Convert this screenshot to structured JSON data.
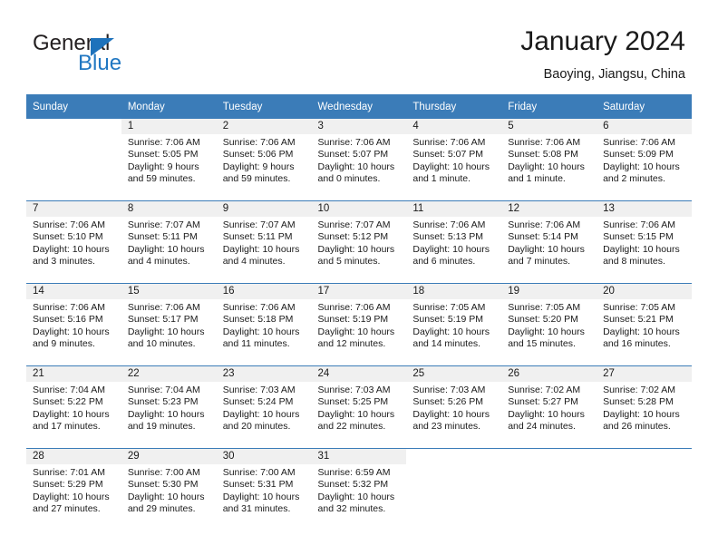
{
  "logo": {
    "word_one": "General",
    "word_two": "Blue",
    "triangle_color": "#1e72bb",
    "blue_color": "#2077c2"
  },
  "header": {
    "title": "January 2024",
    "subtitle": "Baoying, Jiangsu, China",
    "header_bg": "#3b7cb8",
    "header_text_color": "#ffffff",
    "daynum_strip_bg": "#f0f0f0"
  },
  "weekday_headers": [
    "Sunday",
    "Monday",
    "Tuesday",
    "Wednesday",
    "Thursday",
    "Friday",
    "Saturday"
  ],
  "calendar": {
    "month": "January",
    "year": "2024",
    "location": "Baoying, Jiangsu, China",
    "weeks": [
      [
        {
          "day": "",
          "sunrise": "",
          "sunset": "",
          "daylight_1": "",
          "daylight_2": ""
        },
        {
          "day": "1",
          "sunrise": "Sunrise: 7:06 AM",
          "sunset": "Sunset: 5:05 PM",
          "daylight_1": "Daylight: 9 hours",
          "daylight_2": "and 59 minutes."
        },
        {
          "day": "2",
          "sunrise": "Sunrise: 7:06 AM",
          "sunset": "Sunset: 5:06 PM",
          "daylight_1": "Daylight: 9 hours",
          "daylight_2": "and 59 minutes."
        },
        {
          "day": "3",
          "sunrise": "Sunrise: 7:06 AM",
          "sunset": "Sunset: 5:07 PM",
          "daylight_1": "Daylight: 10 hours",
          "daylight_2": "and 0 minutes."
        },
        {
          "day": "4",
          "sunrise": "Sunrise: 7:06 AM",
          "sunset": "Sunset: 5:07 PM",
          "daylight_1": "Daylight: 10 hours",
          "daylight_2": "and 1 minute."
        },
        {
          "day": "5",
          "sunrise": "Sunrise: 7:06 AM",
          "sunset": "Sunset: 5:08 PM",
          "daylight_1": "Daylight: 10 hours",
          "daylight_2": "and 1 minute."
        },
        {
          "day": "6",
          "sunrise": "Sunrise: 7:06 AM",
          "sunset": "Sunset: 5:09 PM",
          "daylight_1": "Daylight: 10 hours",
          "daylight_2": "and 2 minutes."
        }
      ],
      [
        {
          "day": "7",
          "sunrise": "Sunrise: 7:06 AM",
          "sunset": "Sunset: 5:10 PM",
          "daylight_1": "Daylight: 10 hours",
          "daylight_2": "and 3 minutes."
        },
        {
          "day": "8",
          "sunrise": "Sunrise: 7:07 AM",
          "sunset": "Sunset: 5:11 PM",
          "daylight_1": "Daylight: 10 hours",
          "daylight_2": "and 4 minutes."
        },
        {
          "day": "9",
          "sunrise": "Sunrise: 7:07 AM",
          "sunset": "Sunset: 5:11 PM",
          "daylight_1": "Daylight: 10 hours",
          "daylight_2": "and 4 minutes."
        },
        {
          "day": "10",
          "sunrise": "Sunrise: 7:07 AM",
          "sunset": "Sunset: 5:12 PM",
          "daylight_1": "Daylight: 10 hours",
          "daylight_2": "and 5 minutes."
        },
        {
          "day": "11",
          "sunrise": "Sunrise: 7:06 AM",
          "sunset": "Sunset: 5:13 PM",
          "daylight_1": "Daylight: 10 hours",
          "daylight_2": "and 6 minutes."
        },
        {
          "day": "12",
          "sunrise": "Sunrise: 7:06 AM",
          "sunset": "Sunset: 5:14 PM",
          "daylight_1": "Daylight: 10 hours",
          "daylight_2": "and 7 minutes."
        },
        {
          "day": "13",
          "sunrise": "Sunrise: 7:06 AM",
          "sunset": "Sunset: 5:15 PM",
          "daylight_1": "Daylight: 10 hours",
          "daylight_2": "and 8 minutes."
        }
      ],
      [
        {
          "day": "14",
          "sunrise": "Sunrise: 7:06 AM",
          "sunset": "Sunset: 5:16 PM",
          "daylight_1": "Daylight: 10 hours",
          "daylight_2": "and 9 minutes."
        },
        {
          "day": "15",
          "sunrise": "Sunrise: 7:06 AM",
          "sunset": "Sunset: 5:17 PM",
          "daylight_1": "Daylight: 10 hours",
          "daylight_2": "and 10 minutes."
        },
        {
          "day": "16",
          "sunrise": "Sunrise: 7:06 AM",
          "sunset": "Sunset: 5:18 PM",
          "daylight_1": "Daylight: 10 hours",
          "daylight_2": "and 11 minutes."
        },
        {
          "day": "17",
          "sunrise": "Sunrise: 7:06 AM",
          "sunset": "Sunset: 5:19 PM",
          "daylight_1": "Daylight: 10 hours",
          "daylight_2": "and 12 minutes."
        },
        {
          "day": "18",
          "sunrise": "Sunrise: 7:05 AM",
          "sunset": "Sunset: 5:19 PM",
          "daylight_1": "Daylight: 10 hours",
          "daylight_2": "and 14 minutes."
        },
        {
          "day": "19",
          "sunrise": "Sunrise: 7:05 AM",
          "sunset": "Sunset: 5:20 PM",
          "daylight_1": "Daylight: 10 hours",
          "daylight_2": "and 15 minutes."
        },
        {
          "day": "20",
          "sunrise": "Sunrise: 7:05 AM",
          "sunset": "Sunset: 5:21 PM",
          "daylight_1": "Daylight: 10 hours",
          "daylight_2": "and 16 minutes."
        }
      ],
      [
        {
          "day": "21",
          "sunrise": "Sunrise: 7:04 AM",
          "sunset": "Sunset: 5:22 PM",
          "daylight_1": "Daylight: 10 hours",
          "daylight_2": "and 17 minutes."
        },
        {
          "day": "22",
          "sunrise": "Sunrise: 7:04 AM",
          "sunset": "Sunset: 5:23 PM",
          "daylight_1": "Daylight: 10 hours",
          "daylight_2": "and 19 minutes."
        },
        {
          "day": "23",
          "sunrise": "Sunrise: 7:03 AM",
          "sunset": "Sunset: 5:24 PM",
          "daylight_1": "Daylight: 10 hours",
          "daylight_2": "and 20 minutes."
        },
        {
          "day": "24",
          "sunrise": "Sunrise: 7:03 AM",
          "sunset": "Sunset: 5:25 PM",
          "daylight_1": "Daylight: 10 hours",
          "daylight_2": "and 22 minutes."
        },
        {
          "day": "25",
          "sunrise": "Sunrise: 7:03 AM",
          "sunset": "Sunset: 5:26 PM",
          "daylight_1": "Daylight: 10 hours",
          "daylight_2": "and 23 minutes."
        },
        {
          "day": "26",
          "sunrise": "Sunrise: 7:02 AM",
          "sunset": "Sunset: 5:27 PM",
          "daylight_1": "Daylight: 10 hours",
          "daylight_2": "and 24 minutes."
        },
        {
          "day": "27",
          "sunrise": "Sunrise: 7:02 AM",
          "sunset": "Sunset: 5:28 PM",
          "daylight_1": "Daylight: 10 hours",
          "daylight_2": "and 26 minutes."
        }
      ],
      [
        {
          "day": "28",
          "sunrise": "Sunrise: 7:01 AM",
          "sunset": "Sunset: 5:29 PM",
          "daylight_1": "Daylight: 10 hours",
          "daylight_2": "and 27 minutes."
        },
        {
          "day": "29",
          "sunrise": "Sunrise: 7:00 AM",
          "sunset": "Sunset: 5:30 PM",
          "daylight_1": "Daylight: 10 hours",
          "daylight_2": "and 29 minutes."
        },
        {
          "day": "30",
          "sunrise": "Sunrise: 7:00 AM",
          "sunset": "Sunset: 5:31 PM",
          "daylight_1": "Daylight: 10 hours",
          "daylight_2": "and 31 minutes."
        },
        {
          "day": "31",
          "sunrise": "Sunrise: 6:59 AM",
          "sunset": "Sunset: 5:32 PM",
          "daylight_1": "Daylight: 10 hours",
          "daylight_2": "and 32 minutes."
        },
        {
          "day": "",
          "sunrise": "",
          "sunset": "",
          "daylight_1": "",
          "daylight_2": ""
        },
        {
          "day": "",
          "sunrise": "",
          "sunset": "",
          "daylight_1": "",
          "daylight_2": ""
        },
        {
          "day": "",
          "sunrise": "",
          "sunset": "",
          "daylight_1": "",
          "daylight_2": ""
        }
      ]
    ]
  }
}
